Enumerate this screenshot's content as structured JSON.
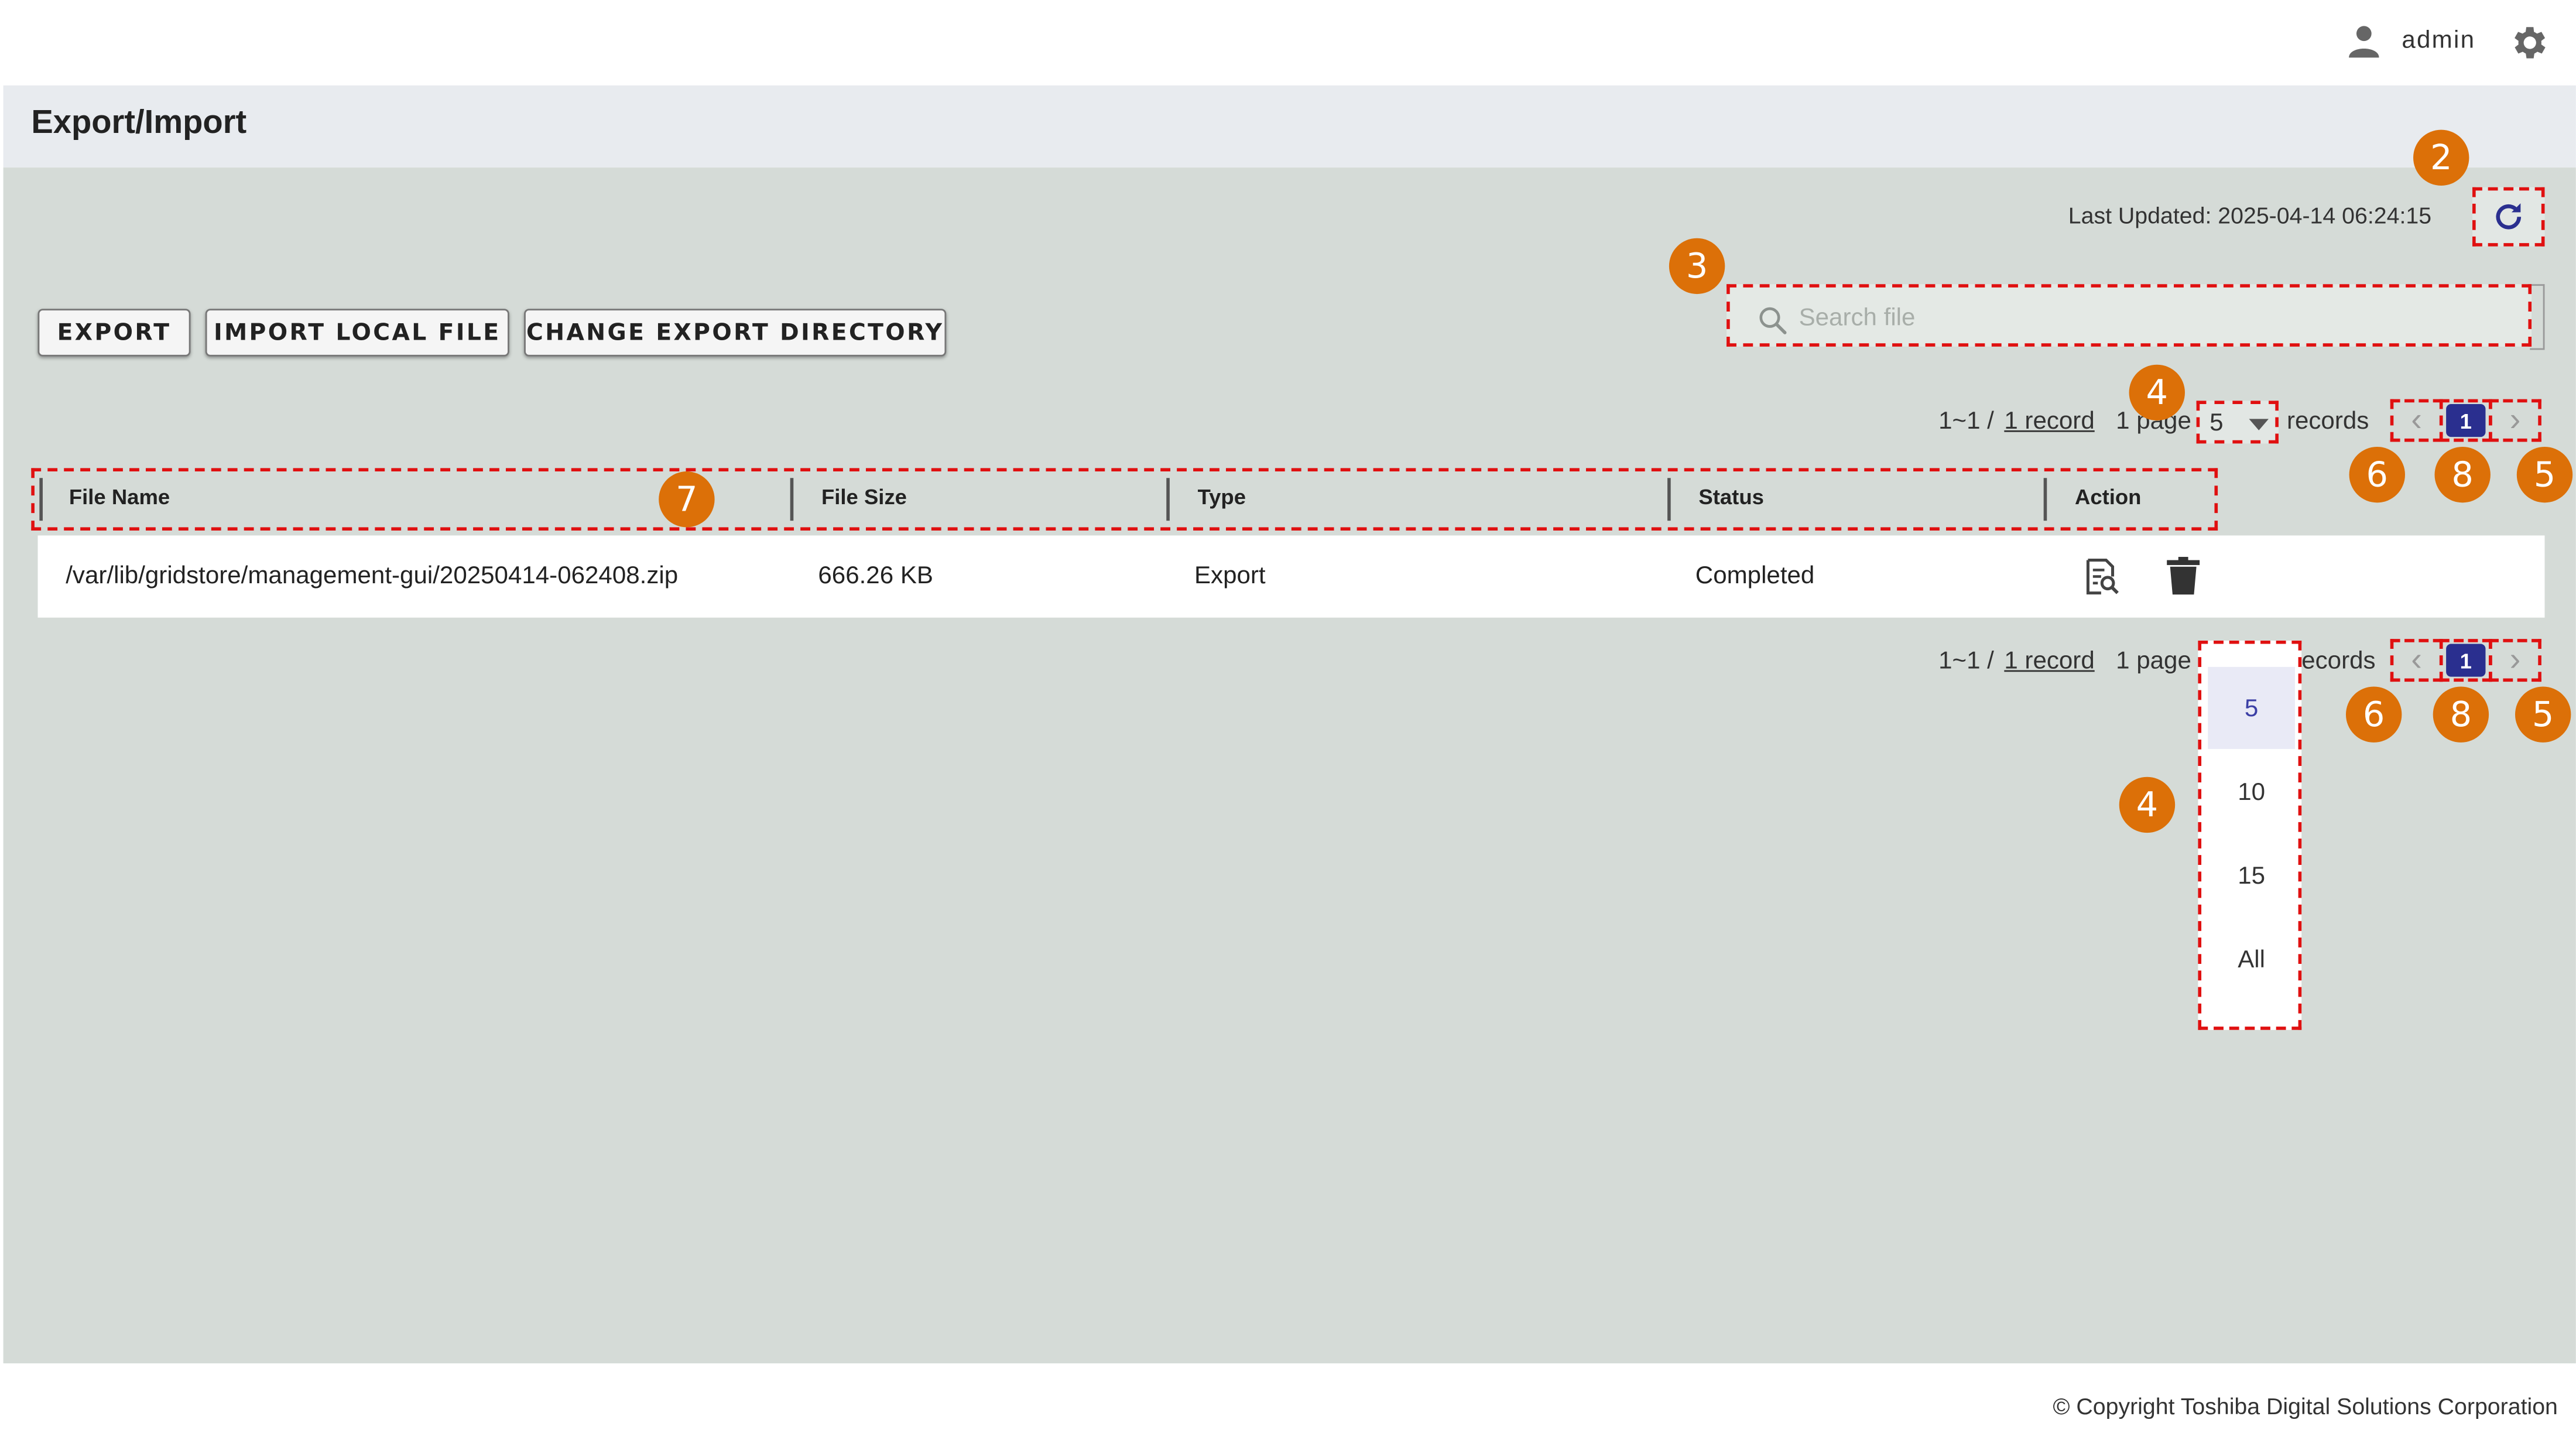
{
  "header": {
    "user_name": "admin"
  },
  "page": {
    "title": "Export/Import",
    "last_updated": "Last Updated: 2025-04-14 06:24:15"
  },
  "toolbar": {
    "export_label": "EXPORT",
    "import_label": "IMPORT LOCAL FILE",
    "change_dir_label": "CHANGE EXPORT DIRECTORY"
  },
  "search": {
    "placeholder": "Search file",
    "value": ""
  },
  "pagination_top": {
    "range": "1~1 /",
    "records_link": "1 record",
    "page_label": "1 page",
    "page_size": "5",
    "records_label": "records",
    "prev": "‹",
    "current": "1",
    "next": "›"
  },
  "pagination_bottom": {
    "range": "1~1 /",
    "records_link": "1 record",
    "page_label": "1 page",
    "records_label": "ecords",
    "prev": "‹",
    "current": "1",
    "next": "›"
  },
  "table": {
    "columns": [
      "File Name",
      "File Size",
      "Type",
      "Status",
      "Action"
    ],
    "rows": [
      {
        "file_name": "/var/lib/gridstore/management-gui/20250414-062408.zip",
        "file_size": "666.26 KB",
        "type": "Export",
        "status": "Completed"
      }
    ]
  },
  "page_size_dropdown": {
    "options": [
      "5",
      "10",
      "15",
      "All"
    ],
    "selected": "5"
  },
  "callouts": {
    "refresh": "2",
    "search": "3",
    "page_size_top": "4",
    "page_size_list": "4",
    "next_top": "5",
    "next_bottom": "5",
    "prev_top": "6",
    "prev_bottom": "6",
    "table_header": "7",
    "page_top": "8",
    "page_bottom": "8"
  },
  "footer": {
    "copyright": "© Copyright Toshiba Digital Solutions Corporation"
  },
  "colors": {
    "accent": "#2a2f8f",
    "callout": "#dc7008",
    "highlight_border": "#e01010",
    "content_bg": "#d5dbd7"
  }
}
